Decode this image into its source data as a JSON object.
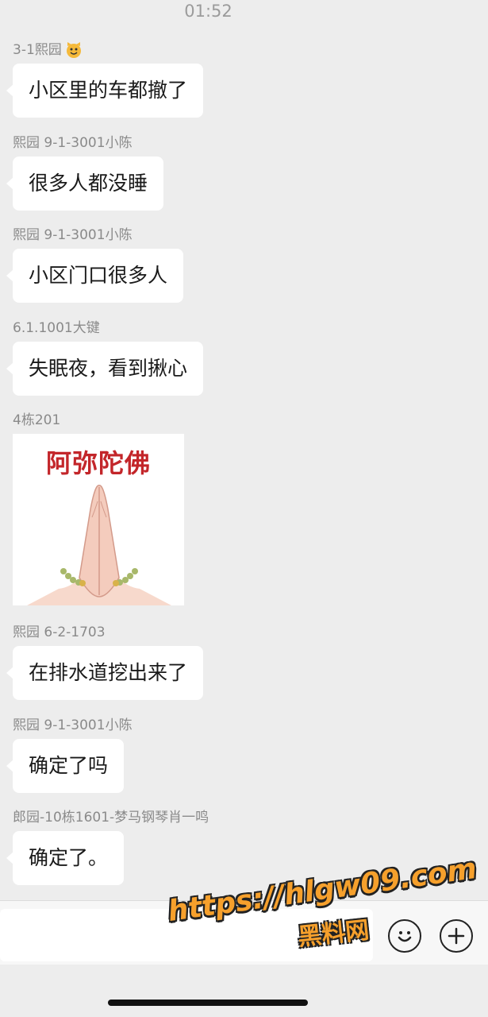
{
  "status_bar": {
    "time": "01:52"
  },
  "messages": [
    {
      "sender": "3-1熙园",
      "text": "小区里的车都撤了"
    },
    {
      "sender": "熙园 9-1-3001小陈",
      "text": "很多人都没睡"
    },
    {
      "sender": "熙园 9-1-3001小陈",
      "text": "小区门口很多人"
    },
    {
      "sender": "6.1.1001大键",
      "text": "失眠夜，看到揪心"
    },
    {
      "sender": "4栋201",
      "sticker_text": "阿弥陀佛"
    },
    {
      "sender": "熙园 6-2-1703",
      "text": "在排水道挖出来了"
    },
    {
      "sender": "熙园 9-1-3001小陈",
      "text": "确定了吗"
    },
    {
      "sender": "郎园-10栋1601-梦马钢琴肖一鸣",
      "text": "确定了。"
    }
  ],
  "icons": {
    "sender_emoji": "cat-face-icon",
    "emoji_button": "smiley-icon",
    "more_button": "plus-icon"
  },
  "watermark": {
    "url": "https://hlgw09.com",
    "name": "黑料网"
  },
  "colors": {
    "background": "#ededed",
    "bubble": "#ffffff",
    "sticker_title": "#c3262a",
    "watermark": "#f6a02c"
  }
}
